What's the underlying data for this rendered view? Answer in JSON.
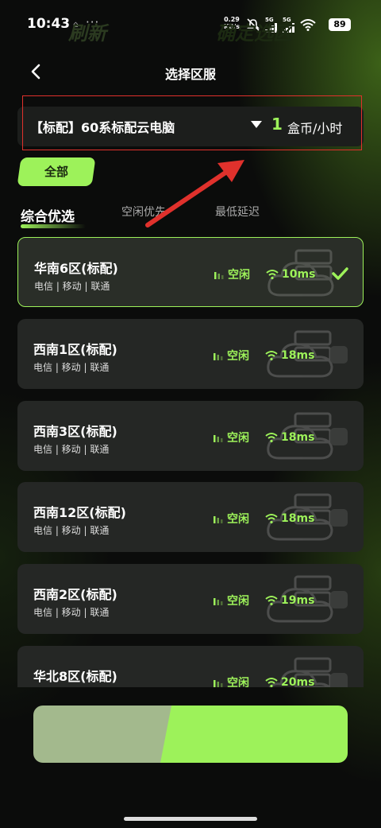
{
  "status_bar": {
    "time": "10:43",
    "ghost": "⌂",
    "dots": "···",
    "speed_value": "0.29",
    "speed_unit": "KB/s",
    "net1": "5G",
    "net2": "5G",
    "battery": "89"
  },
  "header": {
    "title": "选择区服"
  },
  "config": {
    "label": "【标配】60系标配云电脑",
    "price": "1",
    "price_unit": "盒币/小时"
  },
  "filter": {
    "chip_label": "全部"
  },
  "sort_tabs": {
    "active": "综合优选",
    "idle_first": "空闲优先",
    "lowest_latency": "最低延迟"
  },
  "servers": [
    {
      "name": "华南6区(标配)",
      "isp": "电信 | 移动 | 联通",
      "status": "空闲",
      "latency": "10ms",
      "selected": true
    },
    {
      "name": "西南1区(标配)",
      "isp": "电信 | 移动 | 联通",
      "status": "空闲",
      "latency": "18ms",
      "selected": false
    },
    {
      "name": "西南3区(标配)",
      "isp": "电信 | 移动 | 联通",
      "status": "空闲",
      "latency": "18ms",
      "selected": false
    },
    {
      "name": "西南12区(标配)",
      "isp": "电信 | 移动 | 联通",
      "status": "空闲",
      "latency": "18ms",
      "selected": false
    },
    {
      "name": "西南2区(标配)",
      "isp": "电信 | 移动 | 联通",
      "status": "空闲",
      "latency": "19ms",
      "selected": false
    },
    {
      "name": "华北8区(标配)",
      "isp": "电信 | 移动 | 联通",
      "status": "空闲",
      "latency": "20ms",
      "selected": false
    }
  ],
  "buttons": {
    "refresh": "刷新",
    "confirm": "确定选区"
  },
  "colors": {
    "accent": "#9df25a",
    "highlight_box": "#e0312c",
    "annotation_arrow": "#e0312c"
  }
}
